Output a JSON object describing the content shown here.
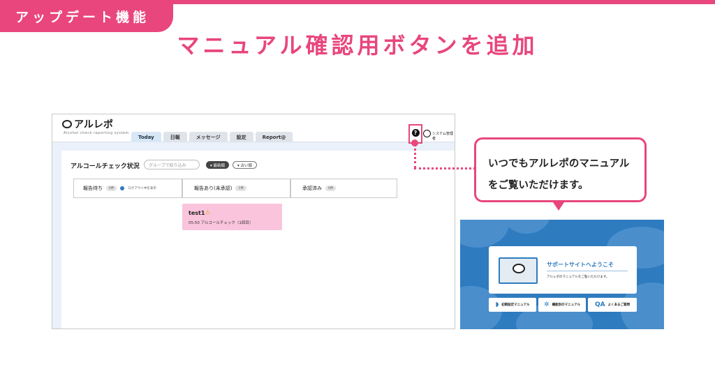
{
  "banner": {
    "ribbon_label": "アップデート機能",
    "headline": "マニュアル確認用ボタンを追加"
  },
  "app": {
    "logo_text": "アルレポ",
    "logo_subtitle": "Alcohol check reporting system",
    "tabs": [
      {
        "label": "Today",
        "active": true
      },
      {
        "label": "日報",
        "active": false
      },
      {
        "label": "メッセージ",
        "active": false
      },
      {
        "label": "設定",
        "active": false
      },
      {
        "label": "Report@",
        "active": false
      }
    ],
    "help_icon_glyph": "?",
    "user_label": "システム管理者",
    "panel_title": "アルコールチェック状況",
    "group_filter_placeholder": "グループで絞り込み",
    "sort_new_label": "▾ 最新順",
    "sort_old_label": "▾ 古い順",
    "steps": [
      {
        "label": "報告待ち",
        "count": "0件",
        "extra": "ログアウト中を表示"
      },
      {
        "label": "報告あり(未承認)",
        "count": "1件"
      },
      {
        "label": "承認済み",
        "count": "0件"
      }
    ],
    "card": {
      "title": "test1",
      "warning_glyph": "⚠",
      "detail": "05:50 アルコールチェック（1回目）"
    }
  },
  "callout": {
    "line1": "いつでもアルレポのマニュアル",
    "line2": "をご覧いただけます。"
  },
  "support_site": {
    "title": "サポートサイトへようこそ",
    "description": "アルレポのマニュアルをご覧いただけます。",
    "buttons": [
      {
        "icon": "beginner-leaf-icon",
        "glyph": "◗",
        "label": "初期設定マニュアル"
      },
      {
        "icon": "gear-icon",
        "glyph": "✲",
        "label": "機能別のマニュアル"
      },
      {
        "icon": "qa-icon",
        "glyph": "QA",
        "label": "よくあるご質問"
      }
    ]
  },
  "colors": {
    "accent_pink": "#e8467c",
    "support_blue": "#2f7bbf",
    "card_pink": "#f9c4dc"
  }
}
